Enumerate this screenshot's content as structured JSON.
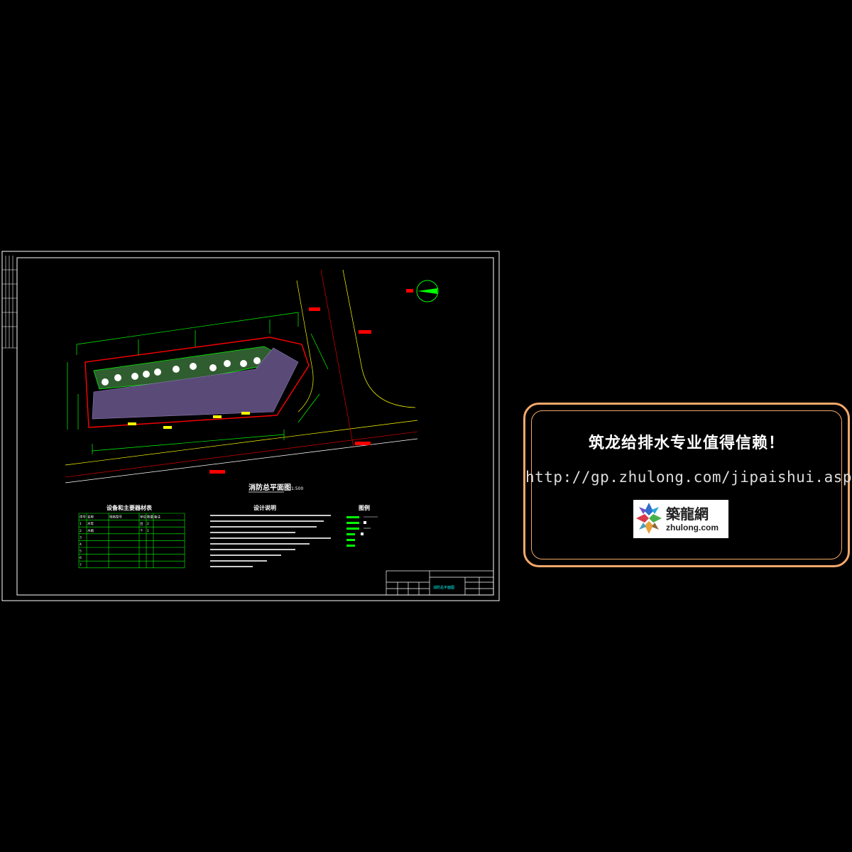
{
  "drawing": {
    "plan_title": "消防总平面图",
    "plan_scale": "1:500",
    "table_title": "设备和主要器材表",
    "table_headers": [
      "序号",
      "名称",
      "规格型号",
      "单位",
      "数量",
      "备注"
    ],
    "table_rows": [
      [
        "1",
        "水泵",
        "",
        "台",
        "2",
        ""
      ],
      [
        "2",
        "水箱",
        "",
        "个",
        "1",
        ""
      ],
      [
        "3",
        "",
        "",
        "",
        "",
        ""
      ],
      [
        "4",
        "",
        "",
        "",
        "",
        ""
      ],
      [
        "5",
        "",
        "",
        "",
        "",
        ""
      ],
      [
        "6",
        "",
        "",
        "",
        "",
        ""
      ],
      [
        "7",
        "",
        "",
        "",
        "",
        ""
      ]
    ],
    "notes_title": "设计说明",
    "legend_title": "图例",
    "titleblock_drawing_name": "消防总平面图",
    "colors": {
      "frame": "#ffffff",
      "dimension": "#00ff00",
      "boundary": "#ff0000",
      "parking_fill": "#5a4a78",
      "green_fill": "#2f5d2f",
      "road_edge": "#ffff00",
      "label": "#00ffff"
    }
  },
  "promo": {
    "title": "筑龙给排水专业值得信赖！",
    "url": "http://gp.zhulong.com/jipaishui.asp",
    "logo_cn": "築龍網",
    "logo_en": "zhulong.com",
    "border_color": "#f4a86a"
  }
}
